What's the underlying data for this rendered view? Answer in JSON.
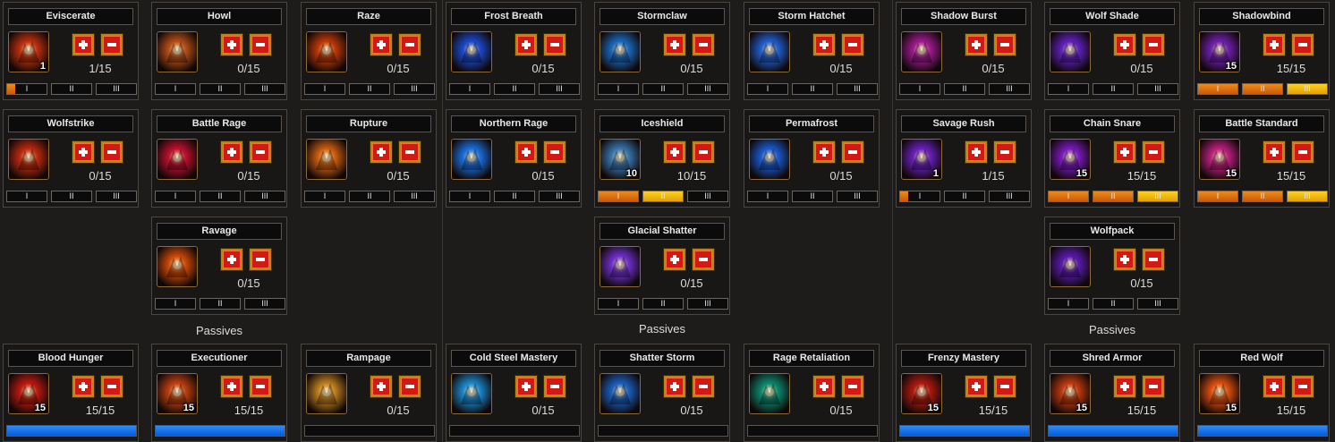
{
  "colors": {
    "tier_fill": "#e8780e",
    "tier_gold": "#ffc20e",
    "passive_fill": "#1a78f0",
    "button_red": "#d21a12",
    "button_border": "#b8860b"
  },
  "sections": [
    {
      "passives_label": "Passives",
      "cards": [
        {
          "name": "Eviscerate",
          "icon": "claw-icon",
          "level": "1",
          "count": "1/15",
          "progress": 0.067,
          "kind": "skill",
          "tiers": [
            {
              "label": "I",
              "fill": 0.2
            },
            {
              "label": "II",
              "fill": 0
            },
            {
              "label": "III",
              "fill": 0
            }
          ],
          "color": "#c0300e"
        },
        {
          "name": "Howl",
          "icon": "howling-werewolf-icon",
          "level": "",
          "count": "0/15",
          "kind": "skill",
          "tiers": [
            {
              "label": "I",
              "fill": 0
            },
            {
              "label": "II",
              "fill": 0
            },
            {
              "label": "III",
              "fill": 0
            }
          ],
          "color": "#b85018"
        },
        {
          "name": "Raze",
          "icon": "fire-skull-icon",
          "level": "",
          "count": "0/15",
          "kind": "skill",
          "tiers": [
            {
              "label": "I",
              "fill": 0
            },
            {
              "label": "II",
              "fill": 0
            },
            {
              "label": "III",
              "fill": 0
            }
          ],
          "color": "#c03a08"
        },
        {
          "name": "Wolfstrike",
          "icon": "fire-wolf-icon",
          "level": "",
          "count": "0/15",
          "kind": "skill",
          "tiers": [
            {
              "label": "I",
              "fill": 0
            },
            {
              "label": "II",
              "fill": 0
            },
            {
              "label": "III",
              "fill": 0
            }
          ],
          "color": "#c02a10"
        },
        {
          "name": "Battle Rage",
          "icon": "rage-face-icon",
          "level": "",
          "count": "0/15",
          "kind": "skill",
          "tiers": [
            {
              "label": "I",
              "fill": 0
            },
            {
              "label": "II",
              "fill": 0
            },
            {
              "label": "III",
              "fill": 0
            }
          ],
          "color": "#c01030"
        },
        {
          "name": "Rupture",
          "icon": "wolf-head-icon",
          "level": "",
          "count": "0/15",
          "kind": "skill",
          "tiers": [
            {
              "label": "I",
              "fill": 0
            },
            {
              "label": "II",
              "fill": 0
            },
            {
              "label": "III",
              "fill": 0
            }
          ],
          "color": "#d06010"
        },
        {
          "name": "Ravage",
          "icon": "skull-crossbones-icon",
          "level": "",
          "count": "0/15",
          "kind": "skill",
          "tiers": [
            {
              "label": "I",
              "fill": 0
            },
            {
              "label": "II",
              "fill": 0
            },
            {
              "label": "III",
              "fill": 0
            }
          ],
          "color": "#d04a08"
        },
        {
          "name": "Blood Hunger",
          "icon": "blood-drops-icon",
          "level": "15",
          "count": "15/15",
          "kind": "passive",
          "progress": 1,
          "color": "#c01a10"
        },
        {
          "name": "Executioner",
          "icon": "crossed-swords-skull-icon",
          "level": "15",
          "count": "15/15",
          "kind": "passive",
          "progress": 1,
          "color": "#c04010"
        },
        {
          "name": "Rampage",
          "icon": "berserker-icon",
          "level": "",
          "count": "0/15",
          "kind": "passive",
          "progress": 0,
          "color": "#c08020"
        }
      ]
    },
    {
      "passives_label": "Passives",
      "cards": [
        {
          "name": "Frost Breath",
          "icon": "frost-wolf-icon",
          "level": "",
          "count": "0/15",
          "kind": "skill",
          "tiers": [
            {
              "label": "I",
              "fill": 0
            },
            {
              "label": "II",
              "fill": 0
            },
            {
              "label": "III",
              "fill": 0
            }
          ],
          "color": "#1a4ad0"
        },
        {
          "name": "Stormclaw",
          "icon": "lightning-claw-icon",
          "level": "",
          "count": "0/15",
          "kind": "skill",
          "tiers": [
            {
              "label": "I",
              "fill": 0
            },
            {
              "label": "II",
              "fill": 0
            },
            {
              "label": "III",
              "fill": 0
            }
          ],
          "color": "#1a6ac0"
        },
        {
          "name": "Storm Hatchet",
          "icon": "storm-axe-icon",
          "level": "",
          "count": "0/15",
          "kind": "skill",
          "tiers": [
            {
              "label": "I",
              "fill": 0
            },
            {
              "label": "II",
              "fill": 0
            },
            {
              "label": "III",
              "fill": 0
            }
          ],
          "color": "#2060d0"
        },
        {
          "name": "Northern Rage",
          "icon": "ice-shards-icon",
          "level": "",
          "count": "0/15",
          "kind": "skill",
          "tiers": [
            {
              "label": "I",
              "fill": 0
            },
            {
              "label": "II",
              "fill": 0
            },
            {
              "label": "III",
              "fill": 0
            }
          ],
          "color": "#1a70e0"
        },
        {
          "name": "Iceshield",
          "icon": "ice-armor-icon",
          "level": "10",
          "count": "10/15",
          "kind": "skill",
          "tiers": [
            {
              "label": "I",
              "fill": 1
            },
            {
              "label": "II",
              "fill": 1,
              "gold": true
            },
            {
              "label": "III",
              "fill": 0
            }
          ],
          "color": "#3a78b0"
        },
        {
          "name": "Permafrost",
          "icon": "frost-ring-icon",
          "level": "",
          "count": "0/15",
          "kind": "skill",
          "tiers": [
            {
              "label": "I",
              "fill": 0
            },
            {
              "label": "II",
              "fill": 0
            },
            {
              "label": "III",
              "fill": 0
            }
          ],
          "color": "#1a5ad0"
        },
        {
          "name": "Glacial Shatter",
          "icon": "shatter-burst-icon",
          "level": "",
          "count": "0/15",
          "kind": "skill",
          "tiers": [
            {
              "label": "I",
              "fill": 0
            },
            {
              "label": "II",
              "fill": 0
            },
            {
              "label": "III",
              "fill": 0
            }
          ],
          "color": "#7030d0"
        },
        {
          "name": "Cold Steel Mastery",
          "icon": "frost-sword-icon",
          "level": "",
          "count": "0/15",
          "kind": "passive",
          "progress": 0,
          "color": "#1a8ad0"
        },
        {
          "name": "Shatter Storm",
          "icon": "ice-skull-icon",
          "level": "",
          "count": "0/15",
          "kind": "passive",
          "progress": 0,
          "color": "#1a60c0"
        },
        {
          "name": "Rage Retaliation",
          "icon": "frost-beast-icon",
          "level": "",
          "count": "0/15",
          "kind": "passive",
          "progress": 0,
          "color": "#0a8a70"
        }
      ]
    },
    {
      "passives_label": "Passives",
      "cards": [
        {
          "name": "Shadow Burst",
          "icon": "shadow-claw-icon",
          "level": "",
          "count": "0/15",
          "kind": "skill",
          "tiers": [
            {
              "label": "I",
              "fill": 0
            },
            {
              "label": "II",
              "fill": 0
            },
            {
              "label": "III",
              "fill": 0
            }
          ],
          "color": "#a01a90"
        },
        {
          "name": "Wolf Shade",
          "icon": "shade-wolf-icon",
          "level": "",
          "count": "0/15",
          "kind": "skill",
          "tiers": [
            {
              "label": "I",
              "fill": 0
            },
            {
              "label": "II",
              "fill": 0
            },
            {
              "label": "III",
              "fill": 0
            }
          ],
          "color": "#6020c0"
        },
        {
          "name": "Shadowbind",
          "icon": "shadow-wolf-head-icon",
          "level": "15",
          "count": "15/15",
          "kind": "skill",
          "tiers": [
            {
              "label": "I",
              "fill": 1
            },
            {
              "label": "II",
              "fill": 1
            },
            {
              "label": "III",
              "fill": 1,
              "gold": true
            }
          ],
          "color": "#7020b0"
        },
        {
          "name": "Savage Rush",
          "icon": "charging-wolf-icon",
          "level": "1",
          "count": "1/15",
          "kind": "skill",
          "tiers": [
            {
              "label": "I",
              "fill": 0.2
            },
            {
              "label": "II",
              "fill": 0
            },
            {
              "label": "III",
              "fill": 0
            }
          ],
          "color": "#6a20c0"
        },
        {
          "name": "Chain Snare",
          "icon": "chain-hook-icon",
          "level": "15",
          "count": "15/15",
          "kind": "skill",
          "tiers": [
            {
              "label": "I",
              "fill": 1
            },
            {
              "label": "II",
              "fill": 1
            },
            {
              "label": "III",
              "fill": 1,
              "gold": true
            }
          ],
          "color": "#7a1ac0"
        },
        {
          "name": "Battle Standard",
          "icon": "war-banner-icon",
          "level": "15",
          "count": "15/15",
          "kind": "skill",
          "tiers": [
            {
              "label": "I",
              "fill": 1
            },
            {
              "label": "II",
              "fill": 1
            },
            {
              "label": "III",
              "fill": 1,
              "gold": true
            }
          ],
          "color": "#c02080"
        },
        {
          "name": "Wolfpack",
          "icon": "wolf-pack-icon",
          "level": "",
          "count": "0/15",
          "kind": "skill",
          "tiers": [
            {
              "label": "I",
              "fill": 0
            },
            {
              "label": "II",
              "fill": 0
            },
            {
              "label": "III",
              "fill": 0
            }
          ],
          "color": "#5a1ab0"
        },
        {
          "name": "Frenzy Mastery",
          "icon": "dragon-fire-icon",
          "level": "15",
          "count": "15/15",
          "kind": "passive",
          "progress": 1,
          "color": "#b01a10"
        },
        {
          "name": "Shred Armor",
          "icon": "shredded-armor-icon",
          "level": "15",
          "count": "15/15",
          "kind": "passive",
          "progress": 1,
          "color": "#c03a10"
        },
        {
          "name": "Red Wolf",
          "icon": "red-wolf-icon",
          "level": "15",
          "count": "15/15",
          "kind": "passive",
          "progress": 1,
          "color": "#e05010"
        }
      ]
    }
  ]
}
